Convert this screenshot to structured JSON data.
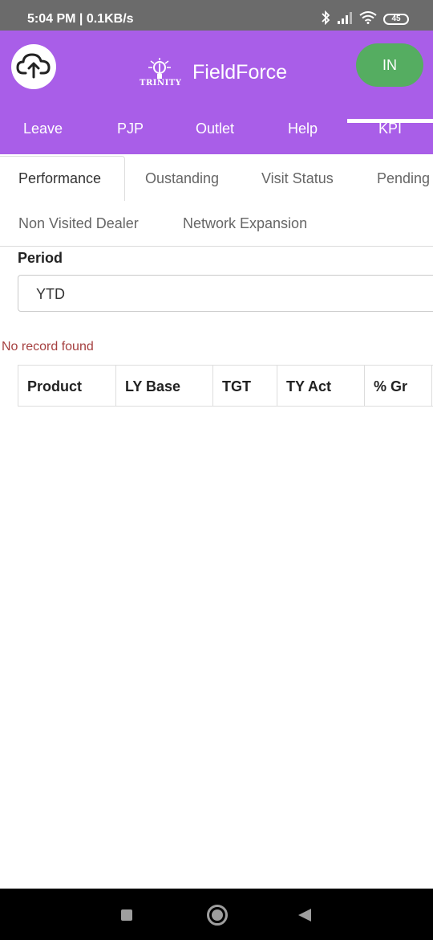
{
  "status_bar": {
    "time_speed": "5:04 PM | 0.1KB/s",
    "battery": "45",
    "bluetooth_icon": "bluetooth-icon",
    "signal_icon": "signal-icon",
    "wifi_icon": "wifi-icon"
  },
  "header": {
    "app_title": "FieldForce",
    "logo_text": "TRINITY",
    "in_button": "IN",
    "upload_icon": "cloud-upload-icon",
    "background_color": "#a95ee8",
    "in_button_color": "#55ad61"
  },
  "nav": {
    "items": [
      "Leave",
      "PJP",
      "Outlet",
      "Help",
      "KPI"
    ],
    "active": "KPI"
  },
  "subtabs": {
    "row1": [
      "Performance",
      "Oustanding",
      "Visit Status",
      "Pending"
    ],
    "row2": [
      "Non Visited Dealer",
      "Network Expansion"
    ],
    "active": "Performance"
  },
  "period": {
    "label": "Period",
    "value": "YTD"
  },
  "message": {
    "no_record": "No record found",
    "color": "#a54040"
  },
  "table": {
    "headers": [
      "Product",
      "LY Base",
      "TGT",
      "TY Act",
      "% Gr"
    ]
  }
}
